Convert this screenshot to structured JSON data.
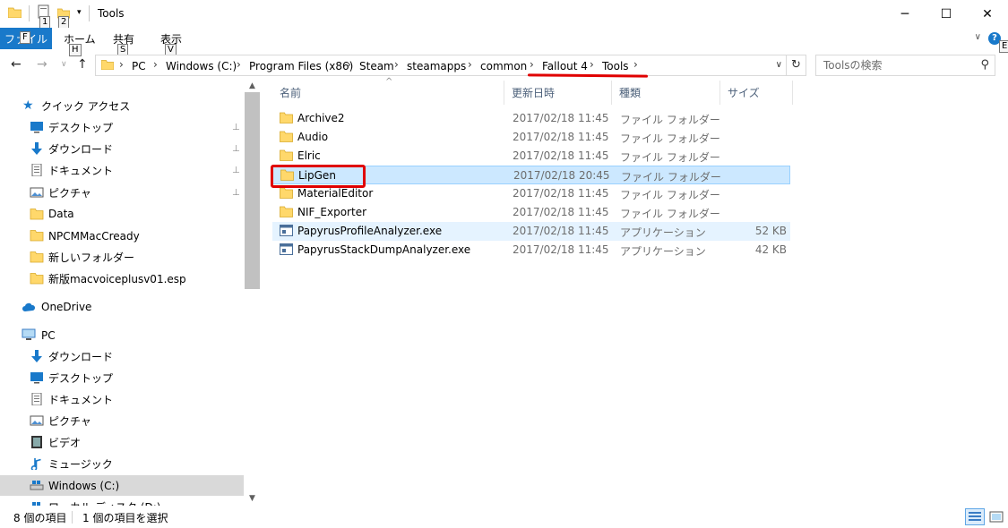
{
  "window": {
    "title": "Tools",
    "qat_keytips": [
      "1",
      "2"
    ],
    "controls": {
      "minimize": "─",
      "maximize": "☐",
      "close": "✕"
    }
  },
  "ribbon": {
    "file_tab": "ファイル",
    "tabs": [
      {
        "label": "ホーム",
        "keytip": "H"
      },
      {
        "label": "共有",
        "keytip": "S"
      },
      {
        "label": "表示",
        "keytip": "V"
      }
    ],
    "file_keytip": "F",
    "help_keytip": "E"
  },
  "address": {
    "crumbs": [
      "PC",
      "Windows (C:)",
      "Program Files (x86)",
      "Steam",
      "steamapps",
      "common",
      "Fallout 4",
      "Tools"
    ]
  },
  "search": {
    "placeholder": "Toolsの検索"
  },
  "navpane": {
    "quick_access": {
      "label": "クイック アクセス",
      "items": [
        {
          "label": "デスクトップ",
          "icon": "desktop-icon",
          "pinned": true
        },
        {
          "label": "ダウンロード",
          "icon": "download-icon",
          "pinned": true
        },
        {
          "label": "ドキュメント",
          "icon": "document-icon",
          "pinned": true
        },
        {
          "label": "ピクチャ",
          "icon": "pictures-icon",
          "pinned": true
        },
        {
          "label": "Data",
          "icon": "folder-icon",
          "pinned": false
        },
        {
          "label": "NPCMMacCready",
          "icon": "folder-icon",
          "pinned": false
        },
        {
          "label": "新しいフォルダー",
          "icon": "folder-icon",
          "pinned": false
        },
        {
          "label": "新版macvoiceplusv01.esp",
          "icon": "folder-icon",
          "pinned": false
        }
      ]
    },
    "onedrive": "OneDrive",
    "pc": {
      "label": "PC",
      "items": [
        {
          "label": "ダウンロード",
          "icon": "download-icon"
        },
        {
          "label": "デスクトップ",
          "icon": "desktop-icon"
        },
        {
          "label": "ドキュメント",
          "icon": "document-icon"
        },
        {
          "label": "ピクチャ",
          "icon": "pictures-icon"
        },
        {
          "label": "ビデオ",
          "icon": "video-icon"
        },
        {
          "label": "ミュージック",
          "icon": "music-icon"
        },
        {
          "label": "Windows (C:)",
          "icon": "drive-icon"
        },
        {
          "label": "ローカル ディスク (D:)",
          "icon": "drive-icon"
        }
      ]
    }
  },
  "filelist": {
    "columns": {
      "name": "名前",
      "date": "更新日時",
      "type": "種類",
      "size": "サイズ"
    },
    "rows": [
      {
        "name": "Archive2",
        "date": "2017/02/18 11:45",
        "type": "ファイル フォルダー",
        "size": "",
        "kind": "folder"
      },
      {
        "name": "Audio",
        "date": "2017/02/18 11:45",
        "type": "ファイル フォルダー",
        "size": "",
        "kind": "folder"
      },
      {
        "name": "Elric",
        "date": "2017/02/18 11:45",
        "type": "ファイル フォルダー",
        "size": "",
        "kind": "folder"
      },
      {
        "name": "LipGen",
        "date": "2017/02/18 20:45",
        "type": "ファイル フォルダー",
        "size": "",
        "kind": "folder"
      },
      {
        "name": "MaterialEditor",
        "date": "2017/02/18 11:45",
        "type": "ファイル フォルダー",
        "size": "",
        "kind": "folder"
      },
      {
        "name": "NIF_Exporter",
        "date": "2017/02/18 11:45",
        "type": "ファイル フォルダー",
        "size": "",
        "kind": "folder"
      },
      {
        "name": "PapyrusProfileAnalyzer.exe",
        "date": "2017/02/18 11:45",
        "type": "アプリケーション",
        "size": "52 KB",
        "kind": "app"
      },
      {
        "name": "PapyrusStackDumpAnalyzer.exe",
        "date": "2017/02/18 11:45",
        "type": "アプリケーション",
        "size": "42 KB",
        "kind": "app"
      }
    ]
  },
  "status": {
    "item_count": "8 個の項目",
    "selected": "1 個の項目を選択"
  },
  "colors": {
    "accent": "#1979ca",
    "selection": "#cce8ff",
    "annotation": "#e00000"
  }
}
